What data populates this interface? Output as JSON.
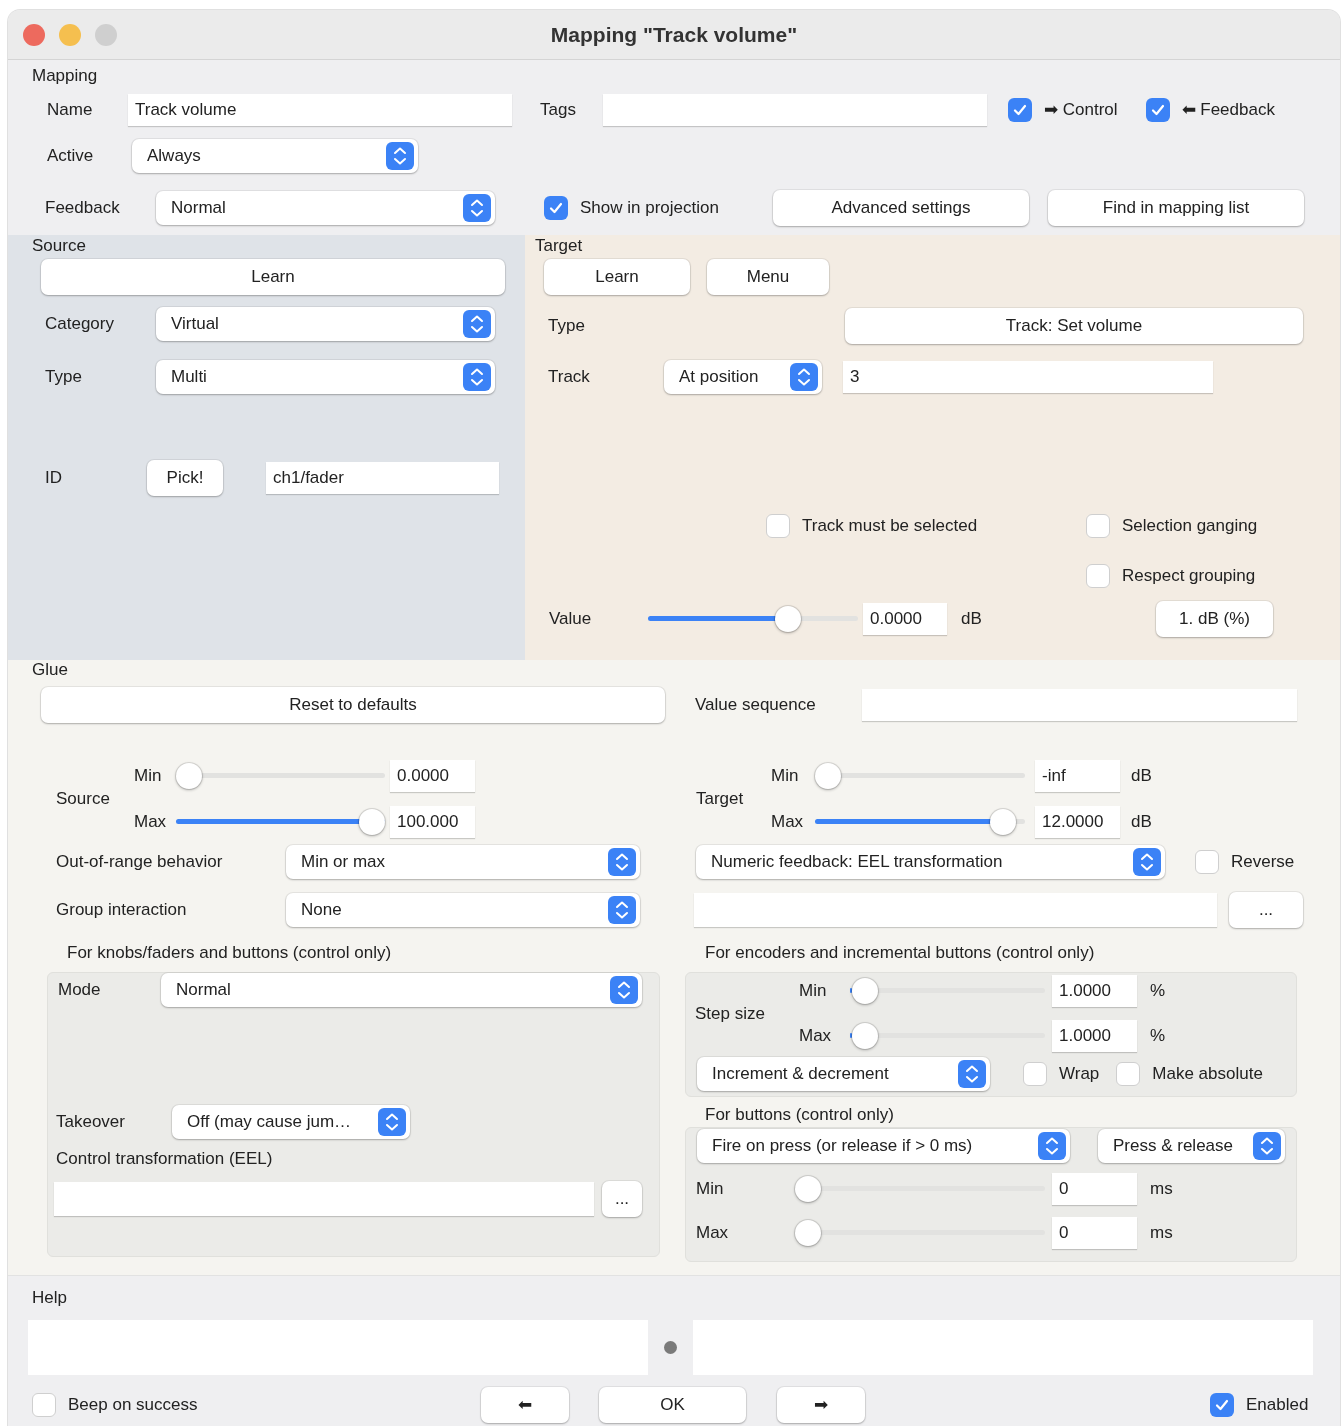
{
  "window": {
    "title": "Mapping \"Track volume\""
  },
  "mapping": {
    "heading": "Mapping",
    "name": {
      "label": "Name",
      "value": "Track volume"
    },
    "tags": {
      "label": "Tags"
    },
    "control": {
      "label": "➡ Control",
      "checked": true
    },
    "feedback_direction": {
      "label": "⬅ Feedback",
      "checked": true
    },
    "active": {
      "label": "Active",
      "value": "Always"
    },
    "feedback": {
      "label": "Feedback",
      "value": "Normal"
    },
    "show_in_projection": {
      "label": "Show in projection",
      "checked": true
    },
    "buttons": [
      "Advanced settings",
      "Find in mapping list"
    ]
  },
  "source": {
    "heading": "Source",
    "learn": "Learn",
    "category": {
      "label": "Category",
      "value": "Virtual"
    },
    "type": {
      "label": "Type",
      "value": "Multi"
    },
    "id": {
      "label": "ID",
      "button": "Pick!",
      "value": "ch1/fader"
    }
  },
  "target": {
    "heading": "Target",
    "buttons": [
      "Learn",
      "Menu"
    ],
    "type": {
      "label": "Type",
      "value": "Track: Set volume"
    },
    "track": {
      "label": "Track",
      "mode": "At position",
      "value": "3"
    },
    "checkboxes": [
      {
        "label": "Track must be selected",
        "checked": false
      },
      {
        "label": "Selection ganging",
        "checked": false
      },
      {
        "label": "Respect grouping",
        "checked": false
      }
    ],
    "value": {
      "label": "Value",
      "level": 0.69,
      "reading": "0.0000",
      "unit": "dB",
      "button": "1. dB (%)"
    }
  },
  "glue": {
    "heading": "Glue",
    "reset": "Reset to defaults",
    "value_sequence": {
      "label": "Value sequence"
    },
    "source_range": {
      "label": "Source",
      "min": {
        "label": "Min",
        "level": 0,
        "value": "0.0000"
      },
      "max": {
        "label": "Max",
        "level": 1,
        "value": "100.000"
      }
    },
    "target_range": {
      "label": "Target",
      "min": {
        "label": "Min",
        "level": 0,
        "value": "-inf",
        "unit": "dB"
      },
      "max": {
        "label": "Max",
        "level": 0.95,
        "value": "12.0000",
        "unit": "dB"
      }
    },
    "out_of_range": {
      "label": "Out-of-range behavior",
      "value": "Min or max"
    },
    "group_interaction": {
      "label": "Group interaction",
      "value": "None"
    },
    "feedback_type": {
      "value": "Numeric feedback: EEL transformation"
    },
    "reverse": {
      "label": "Reverse",
      "checked": false
    },
    "feedback_expression": {
      "button": "..."
    },
    "knobs": {
      "heading": "For knobs/faders and buttons (control only)",
      "mode": {
        "label": "Mode",
        "value": "Normal"
      },
      "takeover": {
        "label": "Takeover",
        "value": "Off (may cause jum…"
      },
      "transformation": {
        "label": "Control transformation (EEL)",
        "button": "..."
      }
    },
    "encoders": {
      "heading": "For encoders and incremental buttons (control only)",
      "step_size": {
        "label": "Step size",
        "min": {
          "label": "Min",
          "level": 0.01,
          "value": "1.0000",
          "unit": "%"
        },
        "max": {
          "label": "Max",
          "level": 0.01,
          "value": "1.0000",
          "unit": "%"
        }
      },
      "mode": {
        "value": "Increment & decrement"
      },
      "wrap": {
        "label": "Wrap",
        "checked": false
      },
      "make_absolute": {
        "label": "Make absolute",
        "checked": false
      }
    },
    "buttons_section": {
      "heading": "For buttons (control only)",
      "fire_mode": {
        "value": "Fire on press (or release if > 0 ms)"
      },
      "button_filter": {
        "value": "Press & release"
      },
      "min": {
        "label": "Min",
        "level": 0,
        "value": "0",
        "unit": "ms"
      },
      "max": {
        "label": "Max",
        "level": 0,
        "value": "0",
        "unit": "ms"
      }
    }
  },
  "help": {
    "heading": "Help",
    "beep_on_success": {
      "label": "Beep on success",
      "checked": false
    },
    "nav_buttons": [
      "⬅",
      "OK",
      "➡"
    ],
    "enabled": {
      "label": "Enabled",
      "checked": true
    }
  }
}
